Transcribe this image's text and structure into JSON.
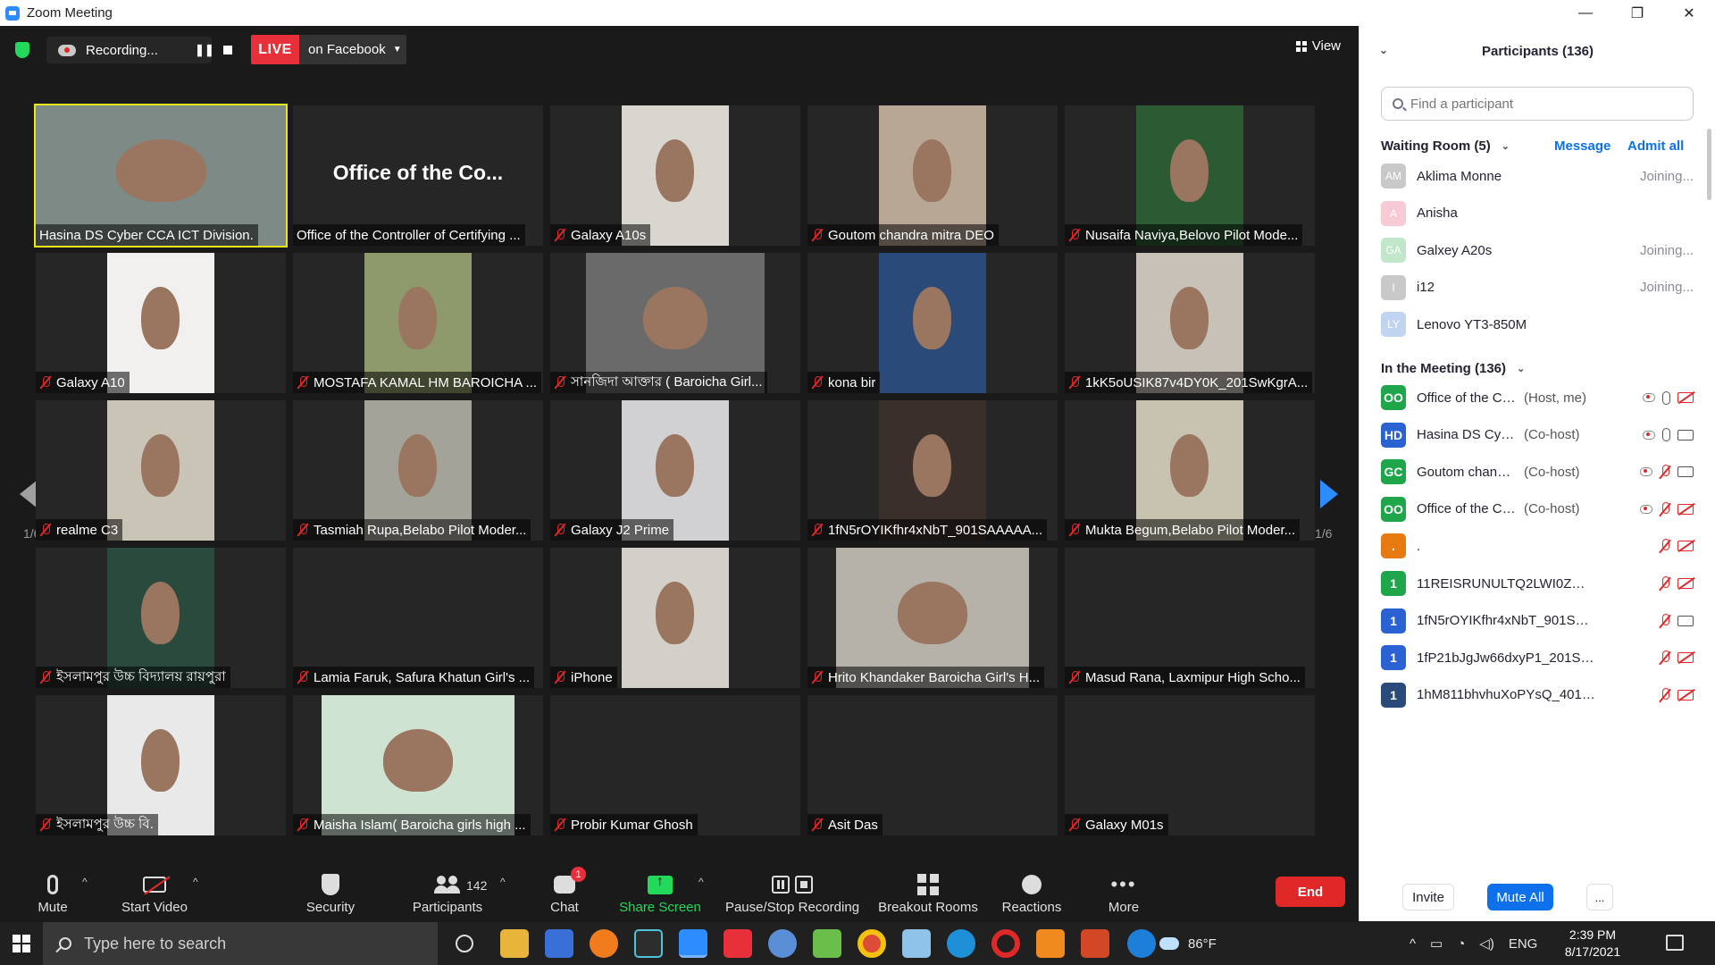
{
  "window": {
    "title": "Zoom Meeting",
    "minimize": "—",
    "maximize": "❐",
    "close": "✕"
  },
  "topbar": {
    "recording_label": "Recording...",
    "pause_glyph": "❚❚",
    "live_label": "LIVE",
    "live_destination": "on Facebook",
    "view_label": "View"
  },
  "tiles": [
    {
      "name": "Hasina DS Cyber CCA ICT Division.",
      "muted": false,
      "active": true,
      "video": "full",
      "bg": "#7d8a86"
    },
    {
      "name": "Office of the Controller of Certifying ...",
      "muted": false,
      "big_text": "Office of the Co...",
      "video": "none"
    },
    {
      "name": "Galaxy A10s",
      "muted": true,
      "video": "narrow",
      "bg": "#d9d6cf"
    },
    {
      "name": "Goutom chandra mitra DEO",
      "muted": true,
      "video": "narrow",
      "bg": "#b9a796"
    },
    {
      "name": "Nusaifa Naviya,Belovo Pilot Mode...",
      "muted": true,
      "video": "mid",
      "bg": "#2c5a32"
    },
    {
      "name": "Galaxy A10",
      "muted": true,
      "video": "narrow",
      "bg": "#f2f0ef"
    },
    {
      "name": "MOSTAFA KAMAL HM BAROICHA ...",
      "muted": true,
      "video": "narrow",
      "bg": "#8f9a6c"
    },
    {
      "name": "সানজিদা আক্তার ( Baroicha Girl...",
      "muted": true,
      "video": "wide",
      "bg": "#6a6a6a"
    },
    {
      "name": "kona bir",
      "muted": true,
      "video": "narrow",
      "bg": "#2a4a7a"
    },
    {
      "name": "1kK5oUSIK87v4DY0K_201SwKgrA...",
      "muted": true,
      "video": "mid",
      "bg": "#c7c1b8"
    },
    {
      "name": "realme C3",
      "muted": true,
      "video": "narrow",
      "bg": "#c9c4b6"
    },
    {
      "name": "Tasmiah Rupa,Belabo Pilot Moder...",
      "muted": true,
      "video": "narrow",
      "bg": "#a4a39a"
    },
    {
      "name": "Galaxy J2 Prime",
      "muted": true,
      "video": "narrow",
      "bg": "#d1d1d3"
    },
    {
      "name": "1fN5rOYIKfhr4xNbT_901SAAAAA...",
      "muted": true,
      "video": "narrow",
      "bg": "#3a2f2a"
    },
    {
      "name": "Mukta Begum,Belabo Pilot Moder...",
      "muted": true,
      "video": "mid",
      "bg": "#c8c2b0"
    },
    {
      "name": "ইসলামপুর উচ্চ বিদ্যালয় রায়পুরা",
      "muted": true,
      "video": "narrow",
      "bg": "#294a3c"
    },
    {
      "name": "Lamia Faruk, Safura Khatun Girl's ...",
      "muted": true,
      "video": "none"
    },
    {
      "name": "iPhone",
      "muted": true,
      "video": "narrow",
      "bg": "#d2d0c8"
    },
    {
      "name": "Hrito Khandaker  Baroicha Girl's H...",
      "muted": true,
      "video": "wider",
      "bg": "#b7b2a9"
    },
    {
      "name": "Masud Rana,  Laxmipur High Scho...",
      "muted": true,
      "video": "none"
    },
    {
      "name": "ইসলামপুর উচ্চ বি.",
      "muted": true,
      "video": "narrow",
      "bg": "#e9e9e9"
    },
    {
      "name": "Maisha Islam( Baroicha girls high ...",
      "muted": true,
      "video": "wider",
      "bg": "#cfe3d3"
    },
    {
      "name": "Probir Kumar Ghosh",
      "muted": true,
      "video": "none"
    },
    {
      "name": "Asit Das",
      "muted": true,
      "video": "none"
    },
    {
      "name": "Galaxy M01s",
      "muted": true,
      "video": "none"
    }
  ],
  "pagination": {
    "left": "1/6",
    "right": "1/6"
  },
  "toolbar": {
    "mute": "Mute",
    "start_video": "Start Video",
    "security": "Security",
    "participants": "Participants",
    "participants_count": "142",
    "chat": "Chat",
    "chat_badge": "1",
    "share_screen": "Share Screen",
    "pause_stop_recording": "Pause/Stop Recording",
    "breakout_rooms": "Breakout Rooms",
    "reactions": "Reactions",
    "more": "More",
    "more_glyph": "•••",
    "end": "End",
    "caret": "^"
  },
  "panel": {
    "title": "Participants (136)",
    "collapse_glyph": "⌄",
    "search_placeholder": "Find a participant",
    "waiting_room_label": "Waiting Room (5)",
    "message_label": "Message",
    "admit_all_label": "Admit all",
    "in_meeting_label": "In the Meeting (136)",
    "chev": "⌄",
    "waiting": [
      {
        "initials": "AM",
        "name": "Aklima Monne",
        "status": "Joining...",
        "color": "#9e9e9e"
      },
      {
        "initials": "A",
        "name": "Anisha",
        "status": "",
        "color": "#f2a0b4"
      },
      {
        "initials": "GA",
        "name": "Galxey A20s",
        "status": "Joining...",
        "color": "#8fd3a0"
      },
      {
        "initials": "I",
        "name": "i12",
        "status": "Joining...",
        "color": "#9e9e9e"
      },
      {
        "initials": "LY",
        "name": "Lenovo YT3-850M",
        "status": "",
        "color": "#8fb4e8"
      }
    ],
    "meeting": [
      {
        "initials": "OO",
        "name": "Office of the Cont...",
        "role": "(Host, me)",
        "color": "#1fa64a",
        "rec": true,
        "mic": "on",
        "cam": "muted"
      },
      {
        "initials": "HD",
        "name": "Hasina DS Cyber C...",
        "role": "(Co-host)",
        "color": "#2a62d4",
        "rec": true,
        "mic": "on",
        "cam": "on"
      },
      {
        "initials": "GC",
        "name": "Goutom chandra ...",
        "role": "(Co-host)",
        "color": "#1fa64a",
        "rec": true,
        "mic": "muted",
        "cam": "on"
      },
      {
        "initials": "OO",
        "name": "Office of the Contr...",
        "role": "(Co-host)",
        "color": "#1fa64a",
        "rec": true,
        "mic": "muted",
        "cam": "muted"
      },
      {
        "initials": ".",
        "name": ".",
        "role": "",
        "color": "#e87a12",
        "rec": false,
        "mic": "muted",
        "cam": "muted"
      },
      {
        "initials": "1",
        "name": "11REISRUNULTQ2LWI0ZWwgTD...",
        "role": "",
        "color": "#1fa64a",
        "rec": false,
        "mic": "muted",
        "cam": "muted"
      },
      {
        "initials": "1",
        "name": "1fN5rOYIKfhr4xNbT_901SAAAAA...",
        "role": "",
        "color": "#2a62d4",
        "rec": false,
        "mic": "muted",
        "cam": "on"
      },
      {
        "initials": "1",
        "name": "1fP21bJgJw66dxyP1_201SwKgrA...",
        "role": "",
        "color": "#2a62d4",
        "rec": false,
        "mic": "muted",
        "cam": "muted"
      },
      {
        "initials": "1",
        "name": "1hM811bhvhuXoPYsQ_401SAAA...",
        "role": "",
        "color": "#2a4a7a",
        "rec": false,
        "mic": "muted",
        "cam": "muted"
      }
    ],
    "invite_label": "Invite",
    "mute_all_label": "Mute All",
    "more_label": "..."
  },
  "taskbar": {
    "search_placeholder": "Type here to search",
    "weather": "86°F",
    "language": "ENG",
    "time": "2:39 PM",
    "date": "8/17/2021"
  }
}
